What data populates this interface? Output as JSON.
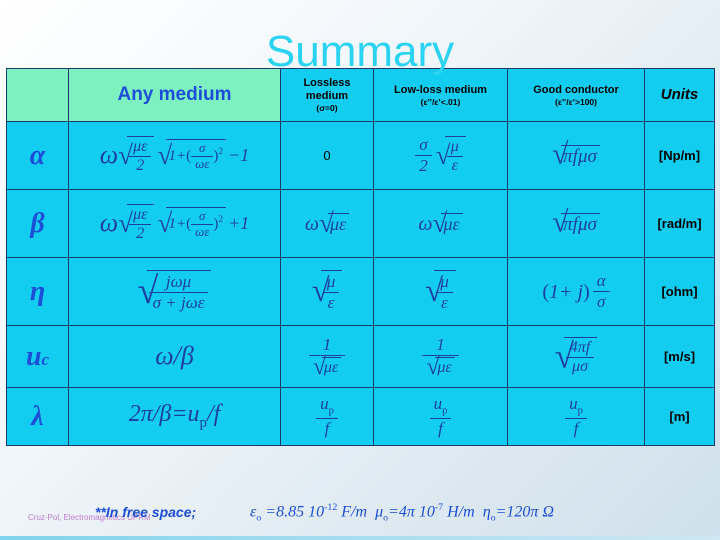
{
  "slide": {
    "title": "Summary",
    "credit": "Cruz-Pol, Electromagnetics UPRM"
  },
  "table": {
    "headers": {
      "any_medium": "Any medium",
      "lossless_medium": "Lossless medium",
      "lossless_medium_cond": "(σ=0)",
      "low_loss_medium": "Low-loss medium",
      "low_loss_cond": "(ε’’/ε’<.01)",
      "good_conductor": "Good conductor",
      "good_conductor_cond": "(ε’’/ε’>100)",
      "units": "Units"
    },
    "rows": [
      {
        "symbol": "α",
        "any_medium": "ω √(με/2) [√(1+(σ/ωε)²) − 1]",
        "lossless": "0",
        "low_loss": "(σ/2) √(μ/ε)",
        "good_conductor": "√(π f μ σ)",
        "units": "[Np/m]"
      },
      {
        "symbol": "β",
        "any_medium": "ω √(με/2) [√(1+(σ/ωε)²) + 1]",
        "lossless": "ω √(με)",
        "low_loss": "ω √(με)",
        "good_conductor": "√(π f μ σ)",
        "units": "[rad/m]"
      },
      {
        "symbol": "η",
        "any_medium": "√( jωμ / (σ + jωε) )",
        "lossless": "√(μ/ε)",
        "low_loss": "√(μ/ε)",
        "good_conductor": "(1 + j) α/σ",
        "units": "[ohm]"
      },
      {
        "symbol": "u",
        "symbol_sub": "c",
        "any_medium": "ω/β",
        "lossless": "1/√(με)",
        "low_loss": "1/√(με)",
        "good_conductor": "√(4π f/μσ)",
        "units": "[m/s]"
      },
      {
        "symbol": "λ",
        "any_medium": "2π/β=uₚ/f",
        "lossless": "uₚ/f",
        "low_loss": "uₚ/f",
        "good_conductor": "uₚ/f",
        "units": "[m]"
      }
    ]
  },
  "footer": {
    "note": "**In free space;",
    "equation_parts": {
      "eps": "ε",
      "eps_sub": "o",
      "eps_val": " =8.85 10",
      "eps_exp": "-12",
      "eps_unit": " F/m",
      "mu": "μ",
      "mu_sub": "o",
      "mu_val": "=4π 10",
      "mu_exp": "-7",
      "mu_unit": " H/m",
      "eta": "η",
      "eta_sub": "o",
      "eta_val": "=120π Ω"
    }
  },
  "colors": {
    "header_green": "#7ff0c0",
    "cell_cyan": "#13cdf0",
    "math_blue": "#1d3fa0",
    "title_cyan": "#2bd3f2"
  }
}
